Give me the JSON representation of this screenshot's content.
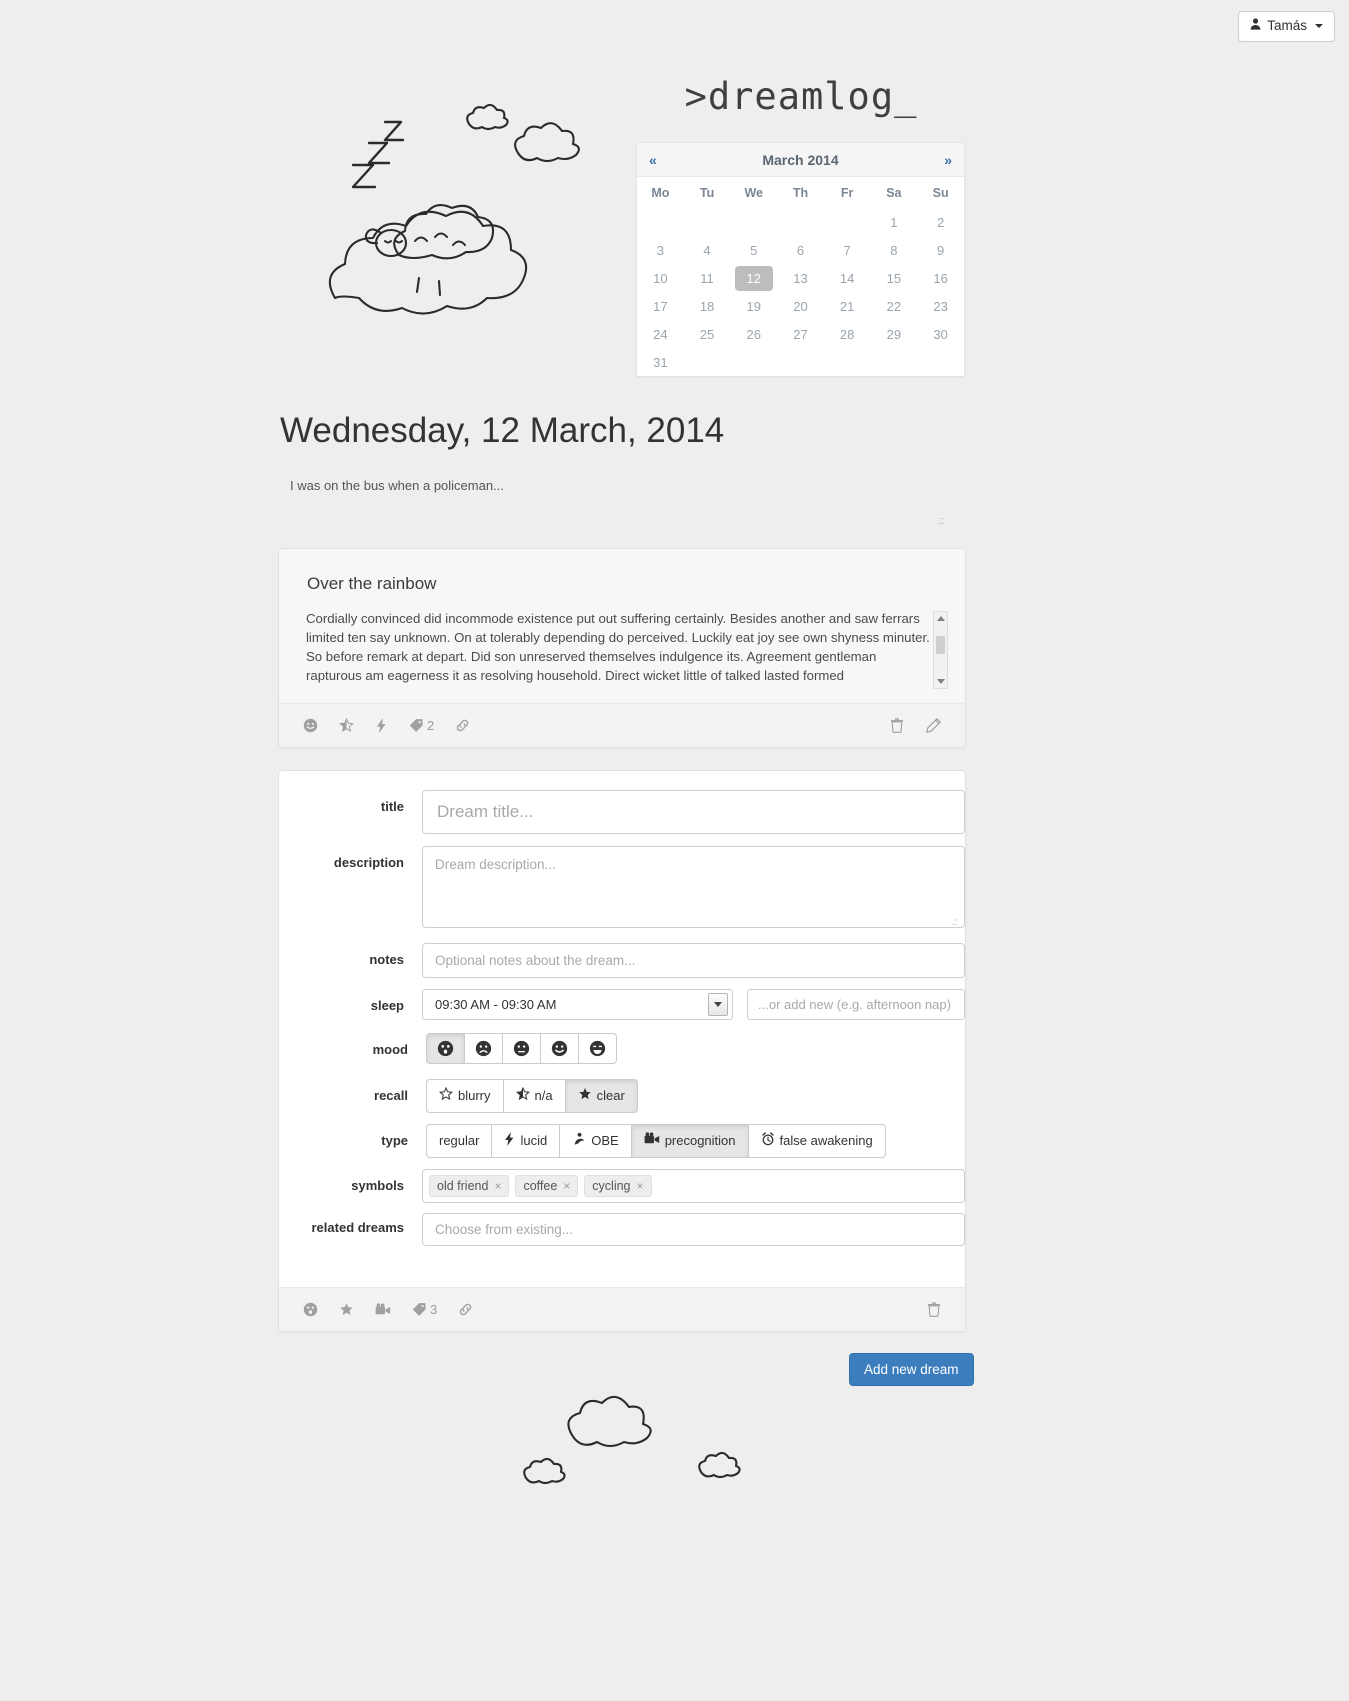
{
  "topbar": {
    "user_label": "Tamás",
    "user_icon": "person-icon",
    "caret_icon": "caret-down-icon"
  },
  "header": {
    "logo_text": ">dreamlog_"
  },
  "calendar": {
    "month_title": "March 2014",
    "prev_label": "«",
    "next_label": "»",
    "weekdays": [
      "Mo",
      "Tu",
      "We",
      "Th",
      "Fr",
      "Sa",
      "Su"
    ],
    "weeks": [
      [
        "",
        "",
        "",
        "",
        "",
        "1",
        "2"
      ],
      [
        "3",
        "4",
        "5",
        "6",
        "7",
        "8",
        "9"
      ],
      [
        "10",
        "11",
        "12",
        "13",
        "14",
        "15",
        "16"
      ],
      [
        "17",
        "18",
        "19",
        "20",
        "21",
        "22",
        "23"
      ],
      [
        "24",
        "25",
        "26",
        "27",
        "28",
        "29",
        "30"
      ],
      [
        "31",
        "",
        "",
        "",
        "",
        "",
        ""
      ]
    ],
    "selected_day": "12",
    "selected_color": "#bdbdbd"
  },
  "page": {
    "date_heading": "Wednesday, 12 March, 2014",
    "teaser": "I was on the bus when a policeman..."
  },
  "dream_card": {
    "title": "Over the rainbow",
    "body": "Cordially convinced did incommode existence put out suffering certainly. Besides another and saw ferrars limited ten say unknown. On at tolerably depending do perceived. Luckily eat joy see own shyness minuter. So before remark at depart. Did son unreserved themselves indulgence its. Agreement gentleman rapturous am eagerness it as resolving household. Direct wicket little of talked lasted formed",
    "footer": {
      "mood_icon": "smiley-face-icon",
      "recall_icon": "half-star-icon",
      "type_icon": "lightning-bolt-icon",
      "tag_icon": "tag-icon",
      "tag_count": "2",
      "link_icon": "link-icon",
      "delete_icon": "trash-icon",
      "edit_icon": "pencil-icon"
    }
  },
  "form": {
    "labels": {
      "title": "title",
      "description": "description",
      "notes": "notes",
      "sleep": "sleep",
      "mood": "mood",
      "recall": "recall",
      "type": "type",
      "symbols": "symbols",
      "related": "related dreams"
    },
    "title_placeholder": "Dream title...",
    "title_value": "",
    "description_placeholder": "Dream description...",
    "description_value": "",
    "notes_placeholder": "Optional notes about the dream...",
    "notes_value": "",
    "sleep_selected": "09:30 AM - 09:30 AM",
    "sleep_options": [
      "09:30 AM - 09:30 AM"
    ],
    "sleep_new_placeholder": "...or add new (e.g. afternoon nap)",
    "sleep_new_value": "",
    "mood_options": [
      {
        "name": "mood-surprised",
        "icon": "surprised-face-icon",
        "selected": true
      },
      {
        "name": "mood-sad",
        "icon": "sad-face-icon",
        "selected": false
      },
      {
        "name": "mood-neutral",
        "icon": "neutral-face-icon",
        "selected": false
      },
      {
        "name": "mood-happy",
        "icon": "happy-face-icon",
        "selected": false
      },
      {
        "name": "mood-grin",
        "icon": "grinning-face-icon",
        "selected": false
      }
    ],
    "recall_options": [
      {
        "label": "blurry",
        "icon": "star-empty-icon",
        "selected": false
      },
      {
        "label": "n/a",
        "icon": "star-half-icon",
        "selected": false
      },
      {
        "label": "clear",
        "icon": "star-full-icon",
        "selected": true
      }
    ],
    "type_options": [
      {
        "label": "regular",
        "icon": "",
        "selected": false
      },
      {
        "label": "lucid",
        "icon": "lightning-bolt-icon",
        "selected": false
      },
      {
        "label": "OBE",
        "icon": "person-ghost-icon",
        "selected": false
      },
      {
        "label": "precognition",
        "icon": "video-camera-icon",
        "selected": true
      },
      {
        "label": "false awakening",
        "icon": "alarm-clock-icon",
        "selected": false
      }
    ],
    "symbols": [
      "old friend",
      "coffee",
      "cycling"
    ],
    "symbol_remove_label": "×",
    "related_placeholder": "Choose from existing...",
    "related_value": "",
    "footer": {
      "mood_icon": "surprised-face-icon",
      "recall_icon": "star-full-icon",
      "type_icon": "video-camera-icon",
      "tag_icon": "tag-icon",
      "tag_count": "3",
      "link_icon": "link-icon",
      "delete_icon": "trash-icon"
    }
  },
  "actions": {
    "add_new_dream": "Add new dream",
    "add_button_color": "#3b7dbd"
  }
}
